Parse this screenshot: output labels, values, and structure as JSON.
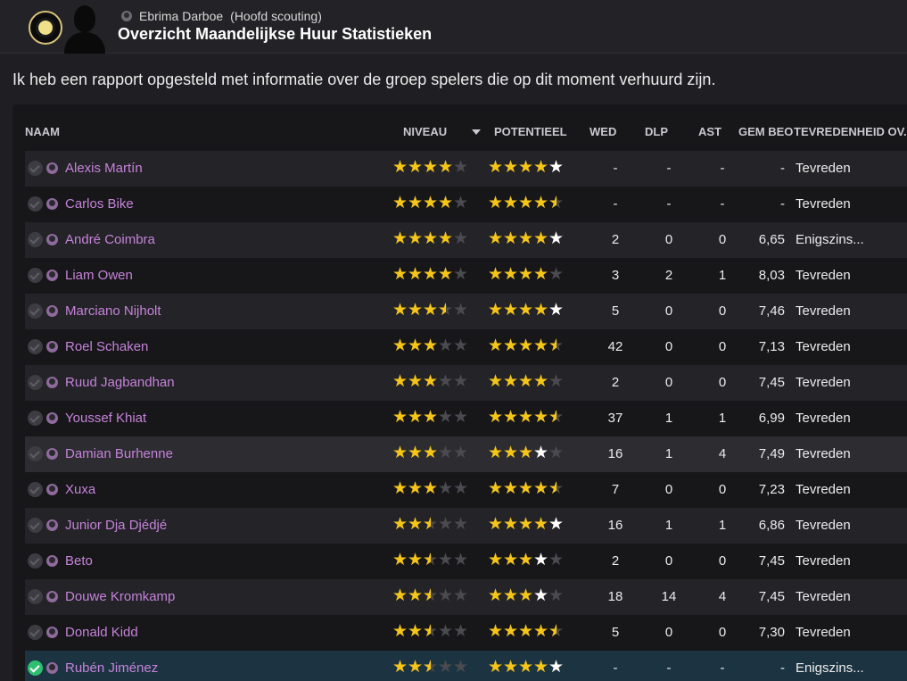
{
  "header": {
    "person_name": "Ebrima Darboe",
    "person_role": "(Hoofd scouting)",
    "title": "Overzicht Maandelijkse Huur Statistieken"
  },
  "intro_text": "Ik heb een rapport opgesteld met informatie over de groep spelers die op dit moment verhuurd zijn.",
  "columns": {
    "naam": "NAAM",
    "niveau": "NIVEAU",
    "potentieel": "POTENTIEEL",
    "wed": "WED",
    "dlp": "DLP",
    "ast": "AST",
    "gem_beo": "GEM BEO",
    "tevredenheid": "TEVREDENHEID OV..."
  },
  "colors": {
    "star_filled_ability": "#f5c518",
    "star_potential_extra": "#ffffff",
    "player_name": "#c583d8"
  },
  "players": [
    {
      "name": "Alexis Martín",
      "niveau": 4,
      "potentieel": 4,
      "pot_extra": 1,
      "wed": "-",
      "dlp": "-",
      "ast": "-",
      "gem": "-",
      "tevredenheid": "Tevreden",
      "checked": false
    },
    {
      "name": "Carlos Bike",
      "niveau": 4,
      "potentieel": 4.5,
      "pot_extra": 0,
      "wed": "-",
      "dlp": "-",
      "ast": "-",
      "gem": "-",
      "tevredenheid": "Tevreden",
      "checked": false
    },
    {
      "name": "André Coimbra",
      "niveau": 4,
      "potentieel": 4,
      "pot_extra": 1,
      "wed": "2",
      "dlp": "0",
      "ast": "0",
      "gem": "6,65",
      "tevredenheid": "Enigszins...",
      "checked": false
    },
    {
      "name": "Liam Owen",
      "niveau": 4,
      "potentieel": 4,
      "pot_extra": 0,
      "wed": "3",
      "dlp": "2",
      "ast": "1",
      "gem": "8,03",
      "tevredenheid": "Tevreden",
      "checked": false
    },
    {
      "name": "Marciano Nijholt",
      "niveau": 3.5,
      "potentieel": 4,
      "pot_extra": 1,
      "wed": "5",
      "dlp": "0",
      "ast": "0",
      "gem": "7,46",
      "tevredenheid": "Tevreden",
      "checked": false
    },
    {
      "name": "Roel Schaken",
      "niveau": 3,
      "potentieel": 4.5,
      "pot_extra": 0,
      "wed": "42",
      "dlp": "0",
      "ast": "0",
      "gem": "7,13",
      "tevredenheid": "Tevreden",
      "checked": false
    },
    {
      "name": "Ruud Jagbandhan",
      "niveau": 3,
      "potentieel": 4,
      "pot_extra": 0,
      "wed": "2",
      "dlp": "0",
      "ast": "0",
      "gem": "7,45",
      "tevredenheid": "Tevreden",
      "checked": false
    },
    {
      "name": "Youssef Khiat",
      "niveau": 3,
      "potentieel": 4.5,
      "pot_extra": 0,
      "wed": "37",
      "dlp": "1",
      "ast": "1",
      "gem": "6,99",
      "tevredenheid": "Tevreden",
      "checked": false
    },
    {
      "name": "Damian Burhenne",
      "niveau": 3,
      "potentieel": 3,
      "pot_extra": 1,
      "wed": "16",
      "dlp": "1",
      "ast": "4",
      "gem": "7,49",
      "tevredenheid": "Tevreden",
      "checked": false
    },
    {
      "name": "Xuxa",
      "niveau": 3,
      "potentieel": 4.5,
      "pot_extra": 0,
      "wed": "7",
      "dlp": "0",
      "ast": "0",
      "gem": "7,23",
      "tevredenheid": "Tevreden",
      "checked": false
    },
    {
      "name": "Junior Dja Djédjé",
      "niveau": 2.5,
      "potentieel": 4,
      "pot_extra": 1,
      "wed": "16",
      "dlp": "1",
      "ast": "1",
      "gem": "6,86",
      "tevredenheid": "Tevreden",
      "checked": false
    },
    {
      "name": "Beto",
      "niveau": 2.5,
      "potentieel": 3,
      "pot_extra": 1,
      "wed": "2",
      "dlp": "0",
      "ast": "0",
      "gem": "7,45",
      "tevredenheid": "Tevreden",
      "checked": false
    },
    {
      "name": "Douwe Kromkamp",
      "niveau": 2.5,
      "potentieel": 3,
      "pot_extra": 1,
      "wed": "18",
      "dlp": "14",
      "ast": "4",
      "gem": "7,45",
      "tevredenheid": "Tevreden",
      "checked": false
    },
    {
      "name": "Donald Kidd",
      "niveau": 2.5,
      "potentieel": 4.5,
      "pot_extra": 0,
      "wed": "5",
      "dlp": "0",
      "ast": "0",
      "gem": "7,30",
      "tevredenheid": "Tevreden",
      "checked": false
    },
    {
      "name": "Rubén Jiménez",
      "niveau": 2.5,
      "potentieel": 4,
      "pot_extra": 1,
      "wed": "-",
      "dlp": "-",
      "ast": "-",
      "gem": "-",
      "tevredenheid": "Enigszins...",
      "checked": true
    }
  ]
}
